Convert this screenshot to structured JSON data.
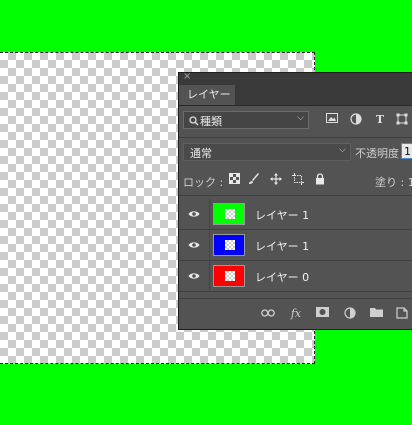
{
  "panel": {
    "close_glyph": "×",
    "tab_label": "レイヤー",
    "filter": {
      "label": "種類",
      "chevron": "⌵",
      "search_glyph": "🔍"
    },
    "blend_mode": {
      "label": "通常",
      "chevron": "⌵"
    },
    "opacity": {
      "label": "不透明度 :",
      "value": "1"
    },
    "lock": {
      "label": "ロック :"
    },
    "fill": {
      "label": "塗り : 1"
    }
  },
  "layers": [
    {
      "name": "レイヤー 1",
      "thumb_color": "#00ff00",
      "visible": true
    },
    {
      "name": "レイヤー 1",
      "thumb_color": "#0000ff",
      "visible": true
    },
    {
      "name": "レイヤー 0",
      "thumb_color": "#ff0000",
      "visible": true
    }
  ],
  "colors": {
    "canvas_background": "#00ff00",
    "panel_bg": "#535353",
    "panel_dark": "#3a3a3a",
    "accent": "#4d8ad6"
  }
}
